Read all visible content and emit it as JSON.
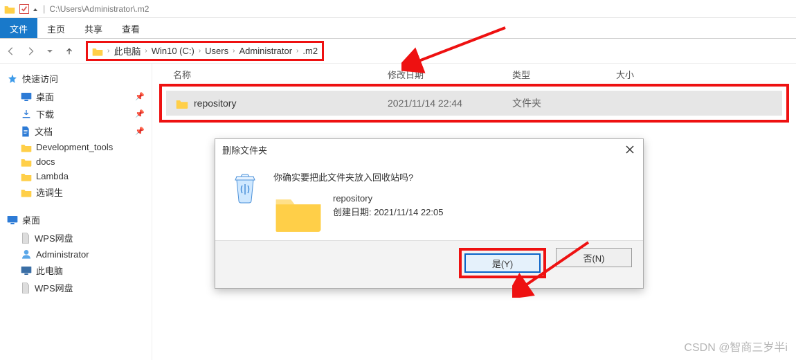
{
  "titlebar": {
    "path": "C:\\Users\\Administrator\\.m2",
    "separator": "|"
  },
  "tabs": {
    "file": "文件",
    "home": "主页",
    "share": "共享",
    "view": "查看"
  },
  "breadcrumb": {
    "items": [
      "此电脑",
      "Win10 (C:)",
      "Users",
      "Administrator",
      ".m2"
    ]
  },
  "sidebar": {
    "quick_access": "快速访问",
    "items": [
      {
        "label": "桌面",
        "icon": "desktop",
        "pinned": true
      },
      {
        "label": "下载",
        "icon": "download",
        "pinned": true
      },
      {
        "label": "文档",
        "icon": "document",
        "pinned": true
      },
      {
        "label": "Development_tools",
        "icon": "folder",
        "pinned": false
      },
      {
        "label": "docs",
        "icon": "folder",
        "pinned": false
      },
      {
        "label": "Lambda",
        "icon": "folder",
        "pinned": false
      },
      {
        "label": "选调生",
        "icon": "folder",
        "pinned": false
      }
    ],
    "desktop_group": "桌面",
    "desktop_items": [
      {
        "label": "WPS网盘",
        "icon": "file"
      },
      {
        "label": "Administrator",
        "icon": "user"
      },
      {
        "label": "此电脑",
        "icon": "pc"
      },
      {
        "label": "WPS网盘",
        "icon": "file"
      }
    ]
  },
  "columns": {
    "name": "名称",
    "modified": "修改日期",
    "type": "类型",
    "size": "大小"
  },
  "row": {
    "name": "repository",
    "modified": "2021/11/14 22:44",
    "type": "文件夹"
  },
  "dialog": {
    "title": "删除文件夹",
    "message": "你确实要把此文件夹放入回收站吗?",
    "item_name": "repository",
    "created_label": "创建日期: 2021/11/14 22:05",
    "yes": "是(Y)",
    "no": "否(N)"
  },
  "watermark": "CSDN @智商三岁半i"
}
